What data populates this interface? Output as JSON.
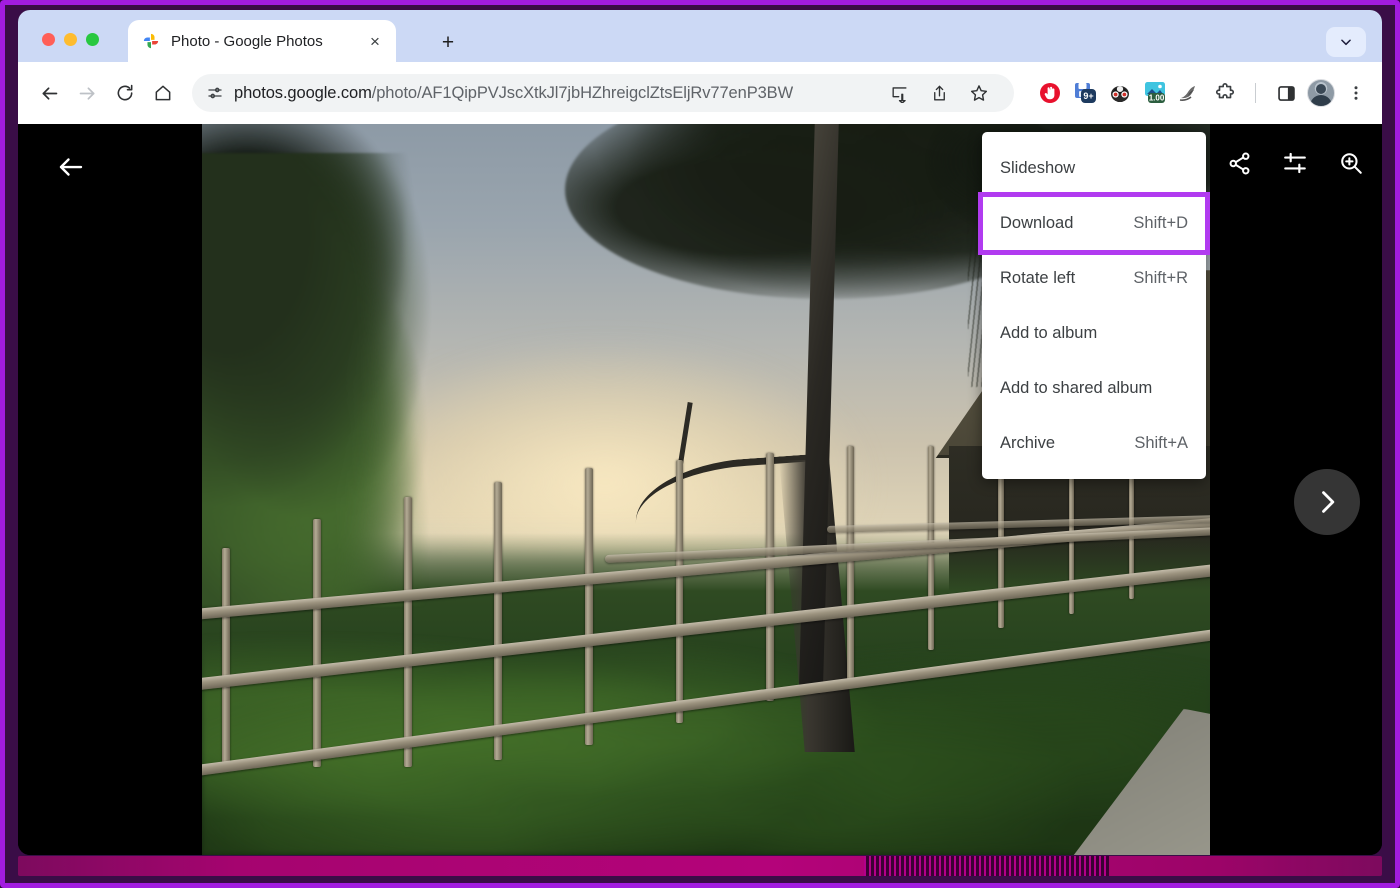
{
  "window": {
    "traffic_lights": [
      "close",
      "minimize",
      "maximize"
    ],
    "frame_accent": "#a21ce0"
  },
  "browser": {
    "tab": {
      "favicon": "google-photos-pinwheel-icon",
      "title": "Photo - Google Photos",
      "close_label": "×"
    },
    "new_tab_label": "+",
    "tab_list_icon": "chevron-down-icon",
    "toolbar": {
      "back_icon": "back-arrow-icon",
      "forward_icon": "forward-arrow-icon",
      "reload_icon": "reload-icon",
      "home_icon": "home-icon",
      "site_info_icon": "site-settings-icon",
      "url": "photos.google.com/photo/AF1QipPVJscXtkJl7jbHZhreigclZtsEljRv77enP3BW",
      "url_host": "photos.google.com",
      "url_path": "/photo/AF1QipPVJscXtkJl7jbHZhreigclZtsEljRv77enP3BW",
      "install_icon": "install-app-icon",
      "share_icon": "share-icon",
      "bookmark_icon": "star-icon",
      "extensions": [
        {
          "name": "adblock-extension-icon",
          "badge": ""
        },
        {
          "name": "notes-extension-icon",
          "badge": "9+"
        },
        {
          "name": "privacy-badger-extension-icon",
          "badge": ""
        },
        {
          "name": "screenshot-extension-icon",
          "badge": "1.00"
        },
        {
          "name": "grammar-extension-icon",
          "badge": ""
        },
        {
          "name": "extensions-puzzle-icon",
          "badge": ""
        }
      ],
      "side_panel_icon": "side-panel-icon",
      "profile_icon": "profile-avatar",
      "menu_icon": "three-dot-menu-icon"
    }
  },
  "viewer": {
    "back_button": "back-arrow-icon",
    "actions": [
      {
        "name": "share-icon",
        "label": "Share"
      },
      {
        "name": "edit-tune-icon",
        "label": "Edit"
      },
      {
        "name": "zoom-in-icon",
        "label": "Zoom in"
      }
    ],
    "next_button": "chevron-right-icon",
    "photo_alt": "Misty sunrise over a village with a bamboo fence, tall tree and thatched hut"
  },
  "context_menu": {
    "highlight_color": "#b13bf0",
    "items": [
      {
        "label": "Slideshow",
        "shortcut": "",
        "highlighted": false
      },
      {
        "label": "Download",
        "shortcut": "Shift+D",
        "highlighted": true
      },
      {
        "label": "Rotate left",
        "shortcut": "Shift+R",
        "highlighted": false
      },
      {
        "label": "Add to album",
        "shortcut": "",
        "highlighted": false
      },
      {
        "label": "Add to shared album",
        "shortcut": "",
        "highlighted": false
      },
      {
        "label": "Archive",
        "shortcut": "Shift+A",
        "highlighted": false
      }
    ]
  }
}
